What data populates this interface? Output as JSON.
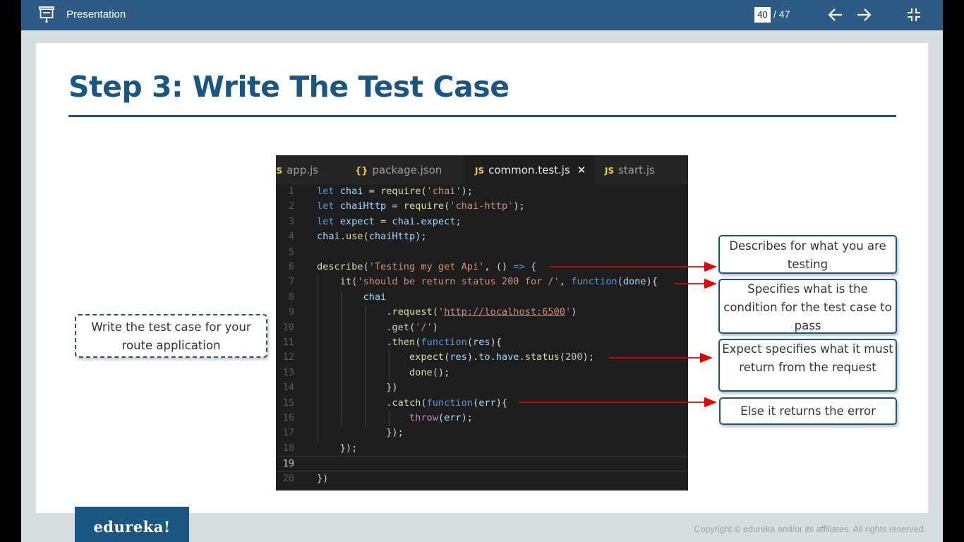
{
  "toolbar": {
    "title": "Presentation",
    "current_page": "40",
    "total_pages": "/ 47",
    "icons": [
      "presentation-icon",
      "arrow-left-icon",
      "arrow-right-icon",
      "exit-fullscreen-icon"
    ]
  },
  "slide": {
    "title": "Step 3: Write The Test Case",
    "tabs": [
      {
        "icon": "JS",
        "label": "app.js"
      },
      {
        "icon": "{}",
        "label": "package.json"
      },
      {
        "icon": "JS",
        "label": "common.test.js",
        "close": "✕"
      },
      {
        "icon": "JS",
        "label": "start.js"
      }
    ],
    "code_lines": [
      {
        "num": "1",
        "code": "let chai = require('chai');"
      },
      {
        "num": "2",
        "code": "let chaiHttp = require('chai-http');"
      },
      {
        "num": "3",
        "code": "let expect = chai.expect;"
      },
      {
        "num": "4",
        "code": "chai.use(chaiHttp);"
      },
      {
        "num": "5",
        "code": ""
      },
      {
        "num": "6",
        "code": "describe('Testing my get Api', () => {"
      },
      {
        "num": "7",
        "code": "    it('should be return status 200 for /', function(done){"
      },
      {
        "num": "8",
        "code": "        chai"
      },
      {
        "num": "9",
        "code": "            .request('http://localhost:6500')"
      },
      {
        "num": "10",
        "code": "            .get('/')"
      },
      {
        "num": "11",
        "code": "            .then(function(res){"
      },
      {
        "num": "12",
        "code": "                expect(res).to.have.status(200);"
      },
      {
        "num": "13",
        "code": "                done();"
      },
      {
        "num": "14",
        "code": "            })"
      },
      {
        "num": "15",
        "code": "            .catch(function(err){"
      },
      {
        "num": "16",
        "code": "                throw(err);"
      },
      {
        "num": "17",
        "code": "            });"
      },
      {
        "num": "18",
        "code": "    });"
      },
      {
        "num": "19",
        "code": ""
      },
      {
        "num": "20",
        "code": "})"
      }
    ],
    "callouts": {
      "left": "Write the test case for your route application",
      "describe": "Describes for what you are testing",
      "it": "Specifies what is the condition for the test case to pass",
      "expect": "Expect specifies what it must return from the request",
      "catch": "Else it returns the error"
    },
    "colors": {
      "accent": "#1b5680",
      "arrow": "#e00000",
      "toolbar": "#2d5b86"
    }
  },
  "footer": {
    "logo": "edureka!",
    "copyright": "Copyright © edureka and/or its affiliates. All rights reserved."
  }
}
